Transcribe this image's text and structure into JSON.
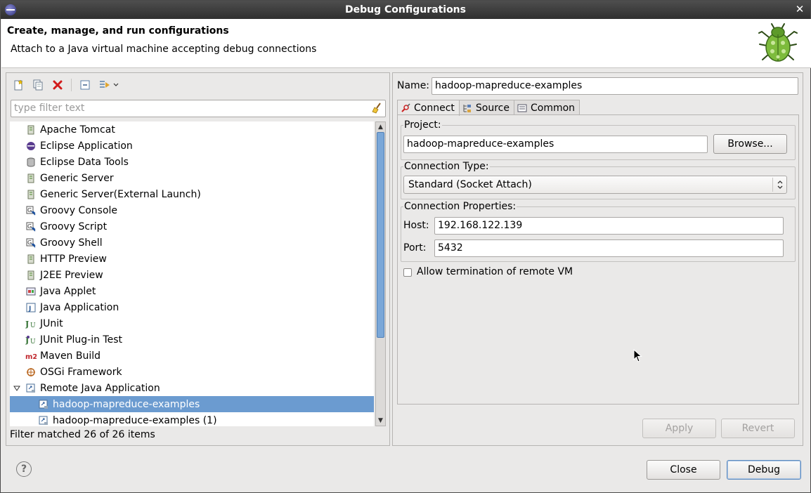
{
  "window": {
    "title": "Debug Configurations"
  },
  "header": {
    "title": "Create, manage, and run configurations",
    "subtitle": "Attach to a Java virtual machine accepting debug connections"
  },
  "left": {
    "toolbar": {
      "new": "new-configuration-icon",
      "duplicate": "duplicate-icon",
      "delete": "delete-icon",
      "collapse": "collapse-all-icon",
      "filter": "filter-icon",
      "dropdown": "chevron-down-icon"
    },
    "filter_placeholder": "type filter text",
    "tree": [
      {
        "label": "Apache Tomcat",
        "icon": "server-icon"
      },
      {
        "label": "Eclipse Application",
        "icon": "eclipse-icon"
      },
      {
        "label": "Eclipse Data Tools",
        "icon": "database-icon"
      },
      {
        "label": "Generic Server",
        "icon": "server-icon"
      },
      {
        "label": "Generic Server(External Launch)",
        "icon": "server-icon"
      },
      {
        "label": "Groovy Console",
        "icon": "groovy-icon"
      },
      {
        "label": "Groovy Script",
        "icon": "groovy-icon"
      },
      {
        "label": "Groovy Shell",
        "icon": "groovy-icon"
      },
      {
        "label": "HTTP Preview",
        "icon": "server-icon"
      },
      {
        "label": "J2EE Preview",
        "icon": "server-icon"
      },
      {
        "label": "Java Applet",
        "icon": "applet-icon"
      },
      {
        "label": "Java Application",
        "icon": "java-app-icon"
      },
      {
        "label": "JUnit",
        "icon": "junit-icon"
      },
      {
        "label": "JUnit Plug-in Test",
        "icon": "junit-plugin-icon"
      },
      {
        "label": "Maven Build",
        "icon": "maven-icon"
      },
      {
        "label": "OSGi Framework",
        "icon": "osgi-icon"
      },
      {
        "label": "Remote Java Application",
        "icon": "remote-java-icon"
      },
      {
        "label": "hadoop-mapreduce-examples",
        "icon": "remote-config-icon"
      },
      {
        "label": "hadoop-mapreduce-examples (1)",
        "icon": "remote-config-icon"
      }
    ],
    "status": "Filter matched 26 of 26 items"
  },
  "right": {
    "name_label": "Name:",
    "name_value": "hadoop-mapreduce-examples",
    "tabs": [
      {
        "label": "Connect",
        "icon": "connect-icon"
      },
      {
        "label": "Source",
        "icon": "source-icon"
      },
      {
        "label": "Common",
        "icon": "common-icon"
      }
    ],
    "project": {
      "group_title": "Project:",
      "value": "hadoop-mapreduce-examples",
      "browse_label": "Browse..."
    },
    "connection_type": {
      "group_title": "Connection Type:",
      "selected": "Standard (Socket Attach)"
    },
    "connection_properties": {
      "group_title": "Connection Properties:",
      "host_label": "Host:",
      "host_value": "192.168.122.139",
      "port_label": "Port:",
      "port_value": "5432"
    },
    "allow_termination_label": "Allow termination of remote VM",
    "apply_label": "Apply",
    "revert_label": "Revert"
  },
  "footer": {
    "help": "?",
    "close_label": "Close",
    "debug_label": "Debug"
  }
}
